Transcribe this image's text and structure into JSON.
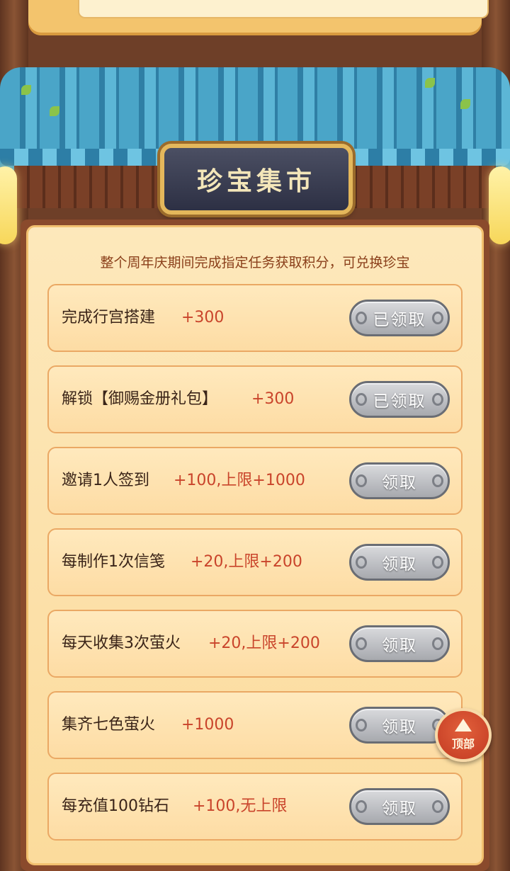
{
  "header": {
    "title": "珍宝集市"
  },
  "subtitle": "整个周年庆期间完成指定任务获取积分，可兑换珍宝",
  "tasks": [
    {
      "label": "完成行宫搭建",
      "points": "+300",
      "button": "已领取"
    },
    {
      "label": "解锁【御赐金册礼包】",
      "points": "+300",
      "button": "已领取"
    },
    {
      "label": "邀请1人签到",
      "points": "+100,上限+1000",
      "button": "领取"
    },
    {
      "label": "每制作1次信笺",
      "points": "+20,上限+200",
      "button": "领取"
    },
    {
      "label": "每天收集3次萤火",
      "points": "+20,上限+200",
      "button": "领取"
    },
    {
      "label": "集齐七色萤火",
      "points": "+1000",
      "button": "领取"
    },
    {
      "label": "每充值100钻石",
      "points": "+100,无上限",
      "button": "领取"
    }
  ],
  "scroll_top_button": {
    "label": "顶部",
    "icon": "arrow-up-icon"
  },
  "colors": {
    "points": "#c9442b",
    "button": "#a7a9ae",
    "panel": "#fbdb9c",
    "roof": "#4aa5c8"
  }
}
